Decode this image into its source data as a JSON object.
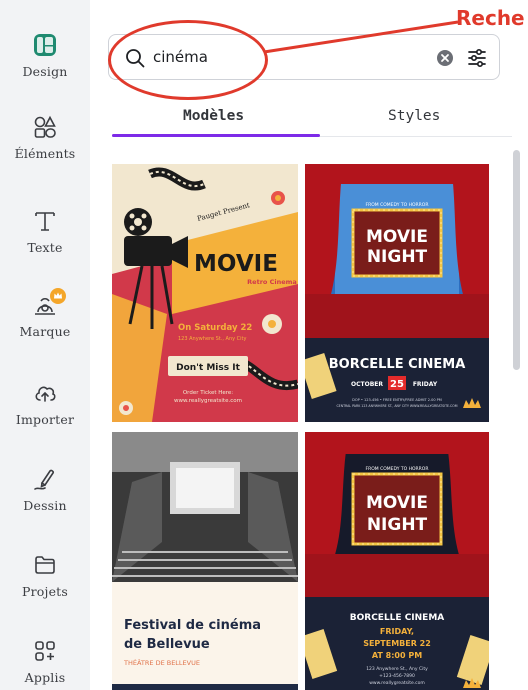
{
  "annotation": {
    "text": "Reche"
  },
  "sidebar": {
    "items": [
      {
        "label": "Design",
        "icon": "design-icon"
      },
      {
        "label": "Éléments",
        "icon": "elements-icon"
      },
      {
        "label": "Texte",
        "icon": "text-icon"
      },
      {
        "label": "Marque",
        "icon": "brand-icon"
      },
      {
        "label": "Importer",
        "icon": "upload-icon"
      },
      {
        "label": "Dessin",
        "icon": "draw-icon"
      },
      {
        "label": "Projets",
        "icon": "folder-icon"
      },
      {
        "label": "Applis",
        "icon": "apps-icon"
      }
    ]
  },
  "search": {
    "value": "cinéma"
  },
  "tabs": [
    {
      "label": "Modèles"
    },
    {
      "label": "Styles"
    }
  ],
  "templates": [
    {
      "heading": "MOVIE",
      "subheading": "Retro Cinema",
      "tag": "Pauget Present",
      "date": "On Saturday 22",
      "address": "123 Anywhere St., Any City",
      "button": "Don't Miss It",
      "order": "Order Ticket Here:",
      "site": "www.reallygreatsite.com"
    },
    {
      "top": "FROM COMEDY TO HORROR",
      "line1": "MOVIE",
      "line2": "NIGHT",
      "venue": "BORCELLE CINEMA",
      "date_left": "OCTOBER",
      "date_num": "25",
      "date_right": "FRIDAY",
      "info1": "DOP • 123-456 • FREE ENTRY/FREE ADMIT 2.00 PM",
      "info2": "CENTRAL PARK 123 ANYWHERE ST., ANY CITY WWW.REALLYGREATSITE.COM"
    },
    {
      "title_line1": "Festival de cinéma",
      "title_line2": "de Bellevue",
      "subtitle": "THÉÂTRE DE BELLEVUE"
    },
    {
      "top": "FROM COMEDY TO HORROR",
      "line1": "MOVIE",
      "line2": "NIGHT",
      "venue": "BORCELLE CINEMA",
      "day": "FRIDAY,",
      "date": "SEPTEMBER 22",
      "time": "AT 8:00 PM",
      "address": "123 Anywhere St., Any City",
      "phone": "+123-456-7890",
      "site": "www.reallygreatsite.com"
    }
  ],
  "colors": {
    "accent": "#7d2ae8",
    "annotation": "#e03a2c",
    "design_icon": "#1f8a70"
  }
}
